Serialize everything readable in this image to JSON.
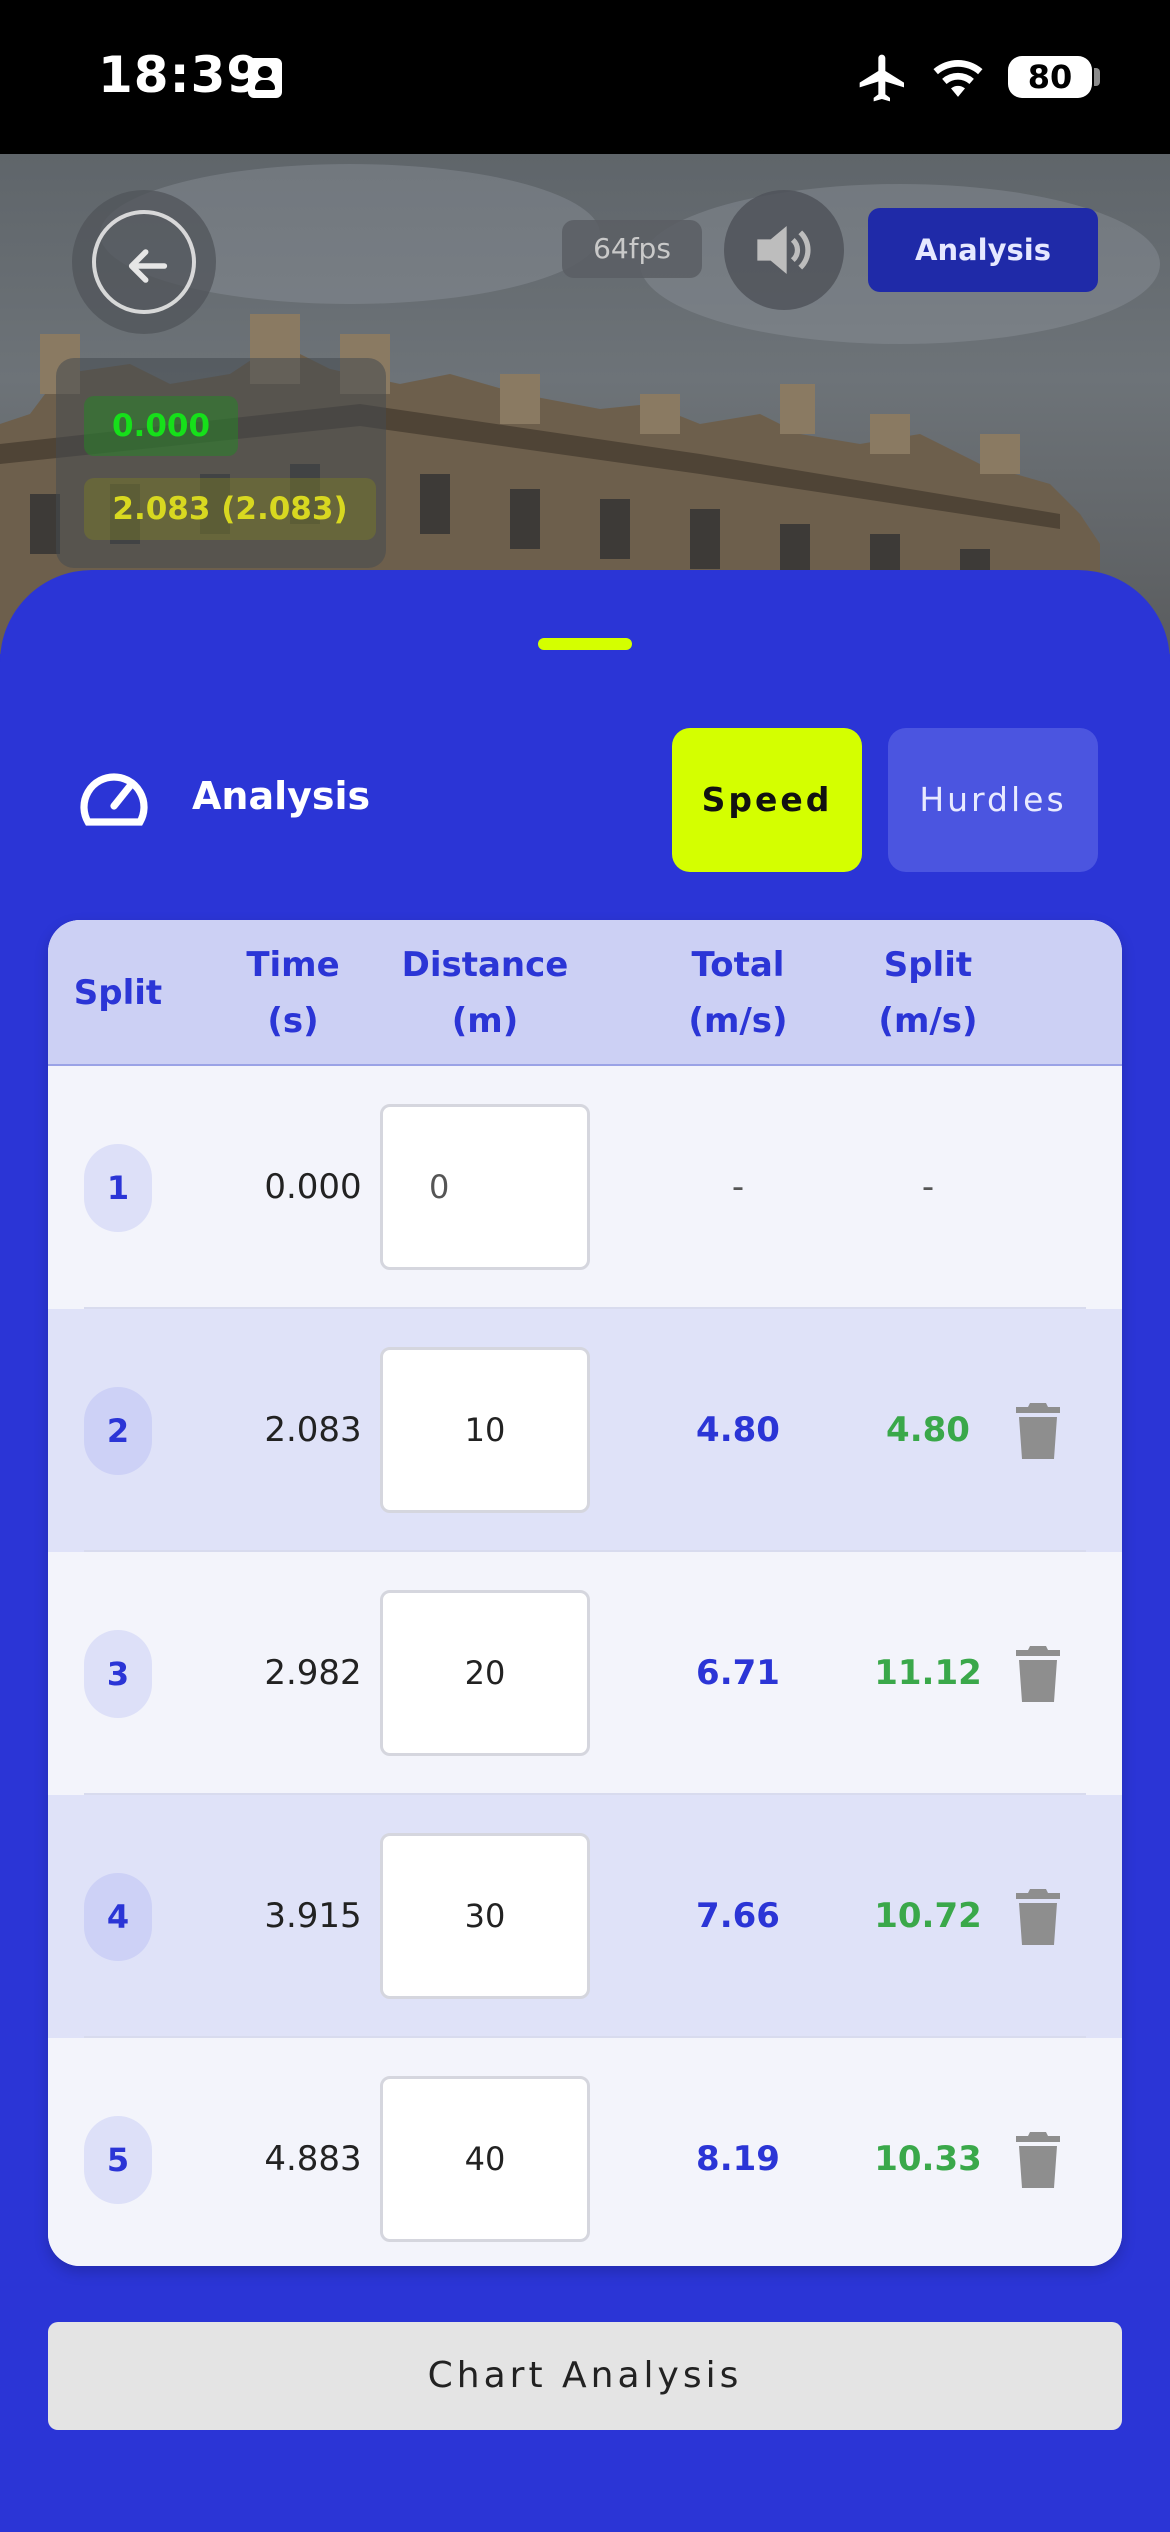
{
  "status_bar": {
    "time": "18:39",
    "battery": "80"
  },
  "video_overlay": {
    "fps": "64fps",
    "analysis_button": "Analysis",
    "timing": [
      "0.000",
      "2.083 (2.083)"
    ]
  },
  "sheet": {
    "title": "Analysis",
    "tabs": [
      {
        "label": "Speed",
        "active": true
      },
      {
        "label": "Hurdles",
        "active": false
      }
    ],
    "columns": [
      "Split",
      "Time\n(s)",
      "Distance\n(m)",
      "Total\n(m/s)",
      "Split\n(m/s)"
    ],
    "rows": [
      {
        "split": "1",
        "time": "0.000",
        "distance": "0",
        "total": "-",
        "split_speed": "-"
      },
      {
        "split": "2",
        "time": "2.083",
        "distance": "10",
        "total": "4.80",
        "split_speed": "4.80"
      },
      {
        "split": "3",
        "time": "2.982",
        "distance": "20",
        "total": "6.71",
        "split_speed": "11.12"
      },
      {
        "split": "4",
        "time": "3.915",
        "distance": "30",
        "total": "7.66",
        "split_speed": "10.72"
      },
      {
        "split": "5",
        "time": "4.883",
        "distance": "40",
        "total": "8.19",
        "split_speed": "10.33"
      }
    ],
    "chart_button": "Chart Analysis"
  },
  "colors": {
    "primary": "#2b35d6",
    "accent": "#d4ff00",
    "split_green": "#3aa84a"
  },
  "icons": [
    "back-arrow-icon",
    "speaker-icon",
    "speedometer-icon",
    "trash-icon",
    "airplane-icon",
    "wifi-icon"
  ]
}
